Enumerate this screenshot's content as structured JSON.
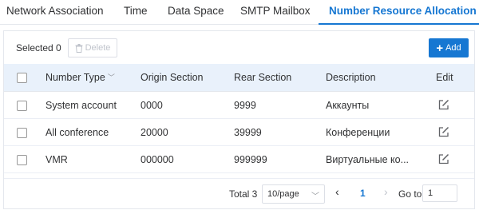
{
  "tabs": [
    {
      "label": "Network Association",
      "active": false
    },
    {
      "label": "Time",
      "active": false
    },
    {
      "label": "Data Space",
      "active": false
    },
    {
      "label": "SMTP Mailbox",
      "active": false
    },
    {
      "label": "Number Resource Allocation",
      "active": true
    }
  ],
  "toolbar": {
    "selected_label": "Selected 0",
    "delete_label": "Delete",
    "add_label": "Add"
  },
  "table": {
    "columns": [
      "Number Type",
      "Origin Section",
      "Rear Section",
      "Description",
      "Edit"
    ],
    "rows": [
      {
        "type": "System account",
        "origin": "0000",
        "rear": "9999",
        "description": "Аккаунты"
      },
      {
        "type": "All conference",
        "origin": "20000",
        "rear": "39999",
        "description": "Конференции"
      },
      {
        "type": "VMR",
        "origin": "000000",
        "rear": "999999",
        "description": "Виртуальные ко..."
      }
    ]
  },
  "pagination": {
    "total_label": "Total 3",
    "page_size": "10/page",
    "current_page": "1",
    "goto_label": "Go to",
    "goto_value": "1"
  },
  "colors": {
    "accent": "#1677d2",
    "header_bg": "#e9f1fb"
  }
}
